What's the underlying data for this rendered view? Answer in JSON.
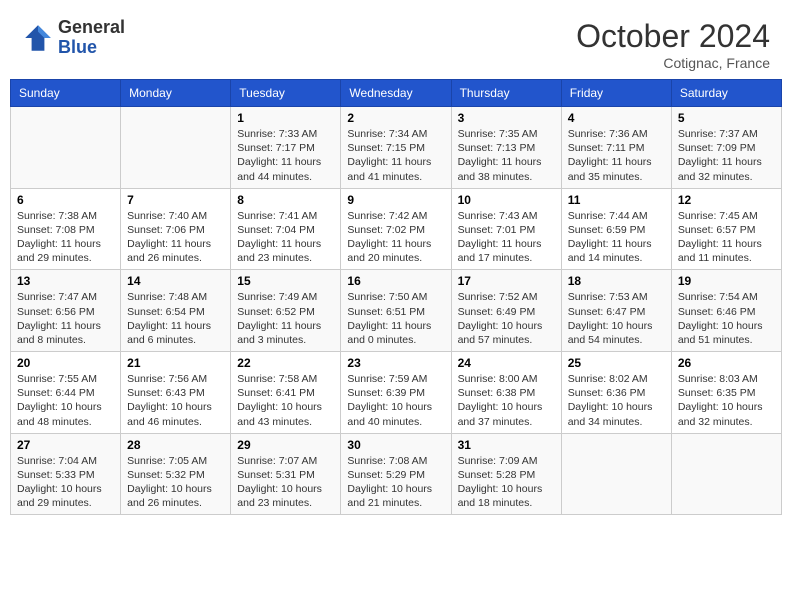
{
  "header": {
    "logo_general": "General",
    "logo_blue": "Blue",
    "month_title": "October 2024",
    "subtitle": "Cotignac, France"
  },
  "weekdays": [
    "Sunday",
    "Monday",
    "Tuesday",
    "Wednesday",
    "Thursday",
    "Friday",
    "Saturday"
  ],
  "weeks": [
    [
      {
        "day": "",
        "sunrise": "",
        "sunset": "",
        "daylight": ""
      },
      {
        "day": "",
        "sunrise": "",
        "sunset": "",
        "daylight": ""
      },
      {
        "day": "1",
        "sunrise": "Sunrise: 7:33 AM",
        "sunset": "Sunset: 7:17 PM",
        "daylight": "Daylight: 11 hours and 44 minutes."
      },
      {
        "day": "2",
        "sunrise": "Sunrise: 7:34 AM",
        "sunset": "Sunset: 7:15 PM",
        "daylight": "Daylight: 11 hours and 41 minutes."
      },
      {
        "day": "3",
        "sunrise": "Sunrise: 7:35 AM",
        "sunset": "Sunset: 7:13 PM",
        "daylight": "Daylight: 11 hours and 38 minutes."
      },
      {
        "day": "4",
        "sunrise": "Sunrise: 7:36 AM",
        "sunset": "Sunset: 7:11 PM",
        "daylight": "Daylight: 11 hours and 35 minutes."
      },
      {
        "day": "5",
        "sunrise": "Sunrise: 7:37 AM",
        "sunset": "Sunset: 7:09 PM",
        "daylight": "Daylight: 11 hours and 32 minutes."
      }
    ],
    [
      {
        "day": "6",
        "sunrise": "Sunrise: 7:38 AM",
        "sunset": "Sunset: 7:08 PM",
        "daylight": "Daylight: 11 hours and 29 minutes."
      },
      {
        "day": "7",
        "sunrise": "Sunrise: 7:40 AM",
        "sunset": "Sunset: 7:06 PM",
        "daylight": "Daylight: 11 hours and 26 minutes."
      },
      {
        "day": "8",
        "sunrise": "Sunrise: 7:41 AM",
        "sunset": "Sunset: 7:04 PM",
        "daylight": "Daylight: 11 hours and 23 minutes."
      },
      {
        "day": "9",
        "sunrise": "Sunrise: 7:42 AM",
        "sunset": "Sunset: 7:02 PM",
        "daylight": "Daylight: 11 hours and 20 minutes."
      },
      {
        "day": "10",
        "sunrise": "Sunrise: 7:43 AM",
        "sunset": "Sunset: 7:01 PM",
        "daylight": "Daylight: 11 hours and 17 minutes."
      },
      {
        "day": "11",
        "sunrise": "Sunrise: 7:44 AM",
        "sunset": "Sunset: 6:59 PM",
        "daylight": "Daylight: 11 hours and 14 minutes."
      },
      {
        "day": "12",
        "sunrise": "Sunrise: 7:45 AM",
        "sunset": "Sunset: 6:57 PM",
        "daylight": "Daylight: 11 hours and 11 minutes."
      }
    ],
    [
      {
        "day": "13",
        "sunrise": "Sunrise: 7:47 AM",
        "sunset": "Sunset: 6:56 PM",
        "daylight": "Daylight: 11 hours and 8 minutes."
      },
      {
        "day": "14",
        "sunrise": "Sunrise: 7:48 AM",
        "sunset": "Sunset: 6:54 PM",
        "daylight": "Daylight: 11 hours and 6 minutes."
      },
      {
        "day": "15",
        "sunrise": "Sunrise: 7:49 AM",
        "sunset": "Sunset: 6:52 PM",
        "daylight": "Daylight: 11 hours and 3 minutes."
      },
      {
        "day": "16",
        "sunrise": "Sunrise: 7:50 AM",
        "sunset": "Sunset: 6:51 PM",
        "daylight": "Daylight: 11 hours and 0 minutes."
      },
      {
        "day": "17",
        "sunrise": "Sunrise: 7:52 AM",
        "sunset": "Sunset: 6:49 PM",
        "daylight": "Daylight: 10 hours and 57 minutes."
      },
      {
        "day": "18",
        "sunrise": "Sunrise: 7:53 AM",
        "sunset": "Sunset: 6:47 PM",
        "daylight": "Daylight: 10 hours and 54 minutes."
      },
      {
        "day": "19",
        "sunrise": "Sunrise: 7:54 AM",
        "sunset": "Sunset: 6:46 PM",
        "daylight": "Daylight: 10 hours and 51 minutes."
      }
    ],
    [
      {
        "day": "20",
        "sunrise": "Sunrise: 7:55 AM",
        "sunset": "Sunset: 6:44 PM",
        "daylight": "Daylight: 10 hours and 48 minutes."
      },
      {
        "day": "21",
        "sunrise": "Sunrise: 7:56 AM",
        "sunset": "Sunset: 6:43 PM",
        "daylight": "Daylight: 10 hours and 46 minutes."
      },
      {
        "day": "22",
        "sunrise": "Sunrise: 7:58 AM",
        "sunset": "Sunset: 6:41 PM",
        "daylight": "Daylight: 10 hours and 43 minutes."
      },
      {
        "day": "23",
        "sunrise": "Sunrise: 7:59 AM",
        "sunset": "Sunset: 6:39 PM",
        "daylight": "Daylight: 10 hours and 40 minutes."
      },
      {
        "day": "24",
        "sunrise": "Sunrise: 8:00 AM",
        "sunset": "Sunset: 6:38 PM",
        "daylight": "Daylight: 10 hours and 37 minutes."
      },
      {
        "day": "25",
        "sunrise": "Sunrise: 8:02 AM",
        "sunset": "Sunset: 6:36 PM",
        "daylight": "Daylight: 10 hours and 34 minutes."
      },
      {
        "day": "26",
        "sunrise": "Sunrise: 8:03 AM",
        "sunset": "Sunset: 6:35 PM",
        "daylight": "Daylight: 10 hours and 32 minutes."
      }
    ],
    [
      {
        "day": "27",
        "sunrise": "Sunrise: 7:04 AM",
        "sunset": "Sunset: 5:33 PM",
        "daylight": "Daylight: 10 hours and 29 minutes."
      },
      {
        "day": "28",
        "sunrise": "Sunrise: 7:05 AM",
        "sunset": "Sunset: 5:32 PM",
        "daylight": "Daylight: 10 hours and 26 minutes."
      },
      {
        "day": "29",
        "sunrise": "Sunrise: 7:07 AM",
        "sunset": "Sunset: 5:31 PM",
        "daylight": "Daylight: 10 hours and 23 minutes."
      },
      {
        "day": "30",
        "sunrise": "Sunrise: 7:08 AM",
        "sunset": "Sunset: 5:29 PM",
        "daylight": "Daylight: 10 hours and 21 minutes."
      },
      {
        "day": "31",
        "sunrise": "Sunrise: 7:09 AM",
        "sunset": "Sunset: 5:28 PM",
        "daylight": "Daylight: 10 hours and 18 minutes."
      },
      {
        "day": "",
        "sunrise": "",
        "sunset": "",
        "daylight": ""
      },
      {
        "day": "",
        "sunrise": "",
        "sunset": "",
        "daylight": ""
      }
    ]
  ]
}
